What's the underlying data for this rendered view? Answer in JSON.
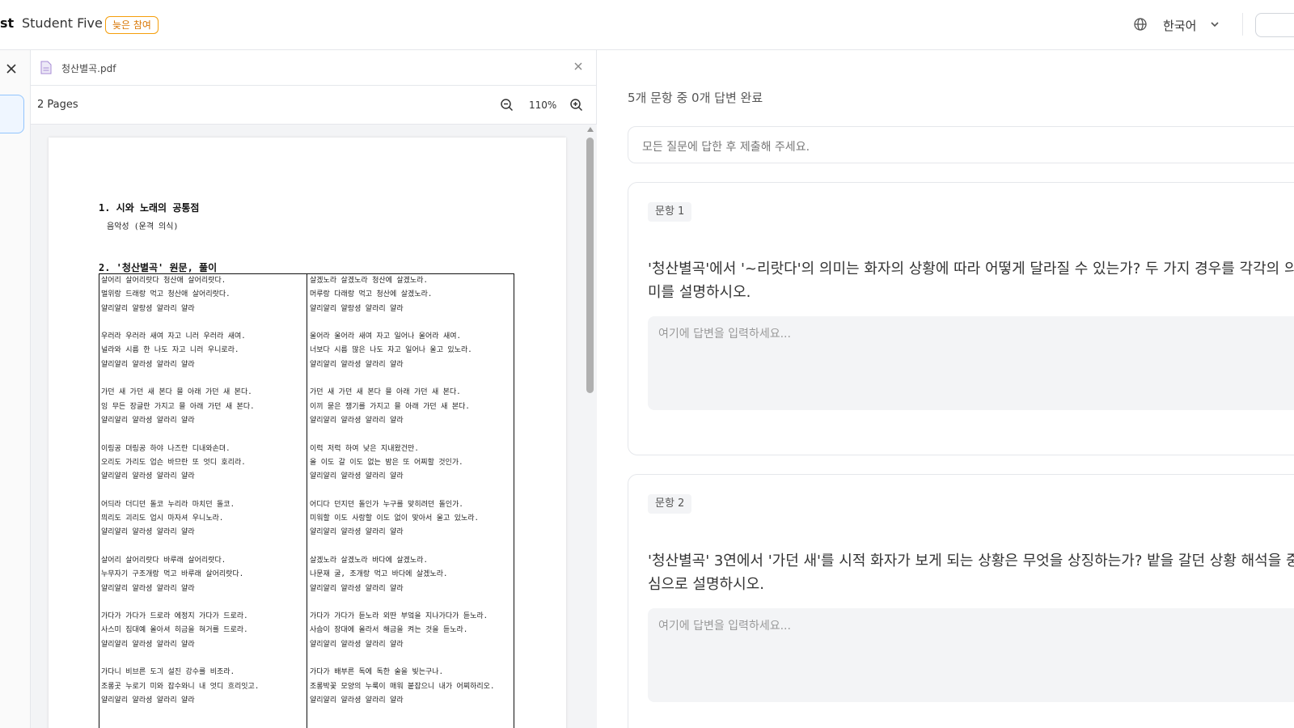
{
  "header": {
    "brand_fragment": "st",
    "student_name": "Student Five",
    "late_badge": "늦은 참여",
    "language": "한국어"
  },
  "viewer": {
    "file_name": "청산별곡.pdf",
    "pages_label": "2 Pages",
    "zoom_level": "110%",
    "document": {
      "heading1": "1. 시와 노래의 공통점",
      "subtext": "음악성 (운격 의식)",
      "heading2": "2. '청산별곡' 원문, 풀이",
      "left_column": [
        [
          "살어리 살어리랏다 청산애 살어리랏다.",
          "멀위랑 드래랑 먹고 청산애 살어리랏다.",
          "얄리얄리 얄랑셩 얄라리 얄라"
        ],
        [
          "우러라 우러라 새여 자고 니러 우러라 새여.",
          "널라와 시름 한 나도 자고 니러 우니로라.",
          "얄리얄리 얄라셩 얄라리 얄라"
        ],
        [
          "가던 새 가던 새 본다 믈 아래 가던 새 본다.",
          "잉 무든 장글란 가지고 믈 아래 가던 새 본다.",
          "얄리얄리 얄라셩 얄라리 얄라"
        ],
        [
          "이링공 뎌링공 하야 나즈란 디내와손뎌.",
          "오리도 가리도 업슨 바므란 또 엇디 호리라.",
          "얄리얄리 얄라셩 얄라리 얄라"
        ],
        [
          "어듸라 더디던 돌코 누리라 마치던 돌코.",
          "믜리도 괴리도 업시 마자셔 우니노라.",
          "얄리얄리 얄라셩 얄라리 얄라"
        ],
        [
          "살어리 살어리랏다 바루래 살어리랏다.",
          "누무자기 구조개랑 먹고 바루래 살어리랏다.",
          "얄리얄리 얄라셩 얄라리 얄라"
        ],
        [
          "가다가 가다가 드로라 에정지 가다가 드로라.",
          "사스미 짐대예 올아셔 히금을 혀거를 드로라.",
          "얄리얄리 얄라셩 얄라리 얄라"
        ],
        [
          "가다니 비브른 도긔 설진 강수를 비조라.",
          "조롱곳 누로기 미와 잡수와니 내 엇디 흐리잇고.",
          "얄리얄리 얄라셩 얄라리 얄라"
        ]
      ],
      "right_column": [
        [
          "살겠노라 살겠노라 청산에 살겠노라.",
          "머루랑 다래랑 먹고 청산에 살겠노라.",
          "얄리얄리 얄랑셩 얄라리 얄라"
        ],
        [
          "울어라 울어라 새여 자고 일어나 울어라 새여.",
          "너보다 시름 많은 나도 자고 일어나 울고 있노라.",
          "얄리얄리 얄라셩 얄라리 얄라"
        ],
        [
          "가던 새 가던 새 본다 믈 아래 가던 새 본다.",
          "이끼 묻은 쟁기를 가지고 믈 아래 가던 새 본다.",
          "얄리얄리 얄라셩 얄라리 얄라"
        ],
        [
          "이럭 저럭 하여 낮은 지내왔건만.",
          "올 이도 갈 이도 없는 밤은 또 어찌할 것인가.",
          "얄리얄리 얄라셩 얄라리 얄라"
        ],
        [
          "어디다 던지던 돌인가 누구를 맞히려던 돌인가.",
          "미워할 이도 사랑할 이도 없이 맞아서 울고 있노라.",
          "얄리얄리 얄라셩 얄라리 얄라"
        ],
        [
          "살겠노라 살겠노라 바다에 살겠노라.",
          "나문재 굴, 조개랑 먹고 바다에 살겠노라.",
          "얄리얄리 얄라셩 얄라리 얄라"
        ],
        [
          "가다가 가다가 듣노라 외딴 부엌을 지나가다가 듣노라.",
          "사슴이 장대에 올라서 해금을 켜는 것을 듣노라.",
          "얄리얄리 얄라셩 얄라리 얄라"
        ],
        [
          "가다가 배부른 독에 독한 술을 빚는구나.",
          "조롱박꽃 모양의 누룩이 매워 붙잡으니 내가 어찌하리오.",
          "얄리얄리 얄라셩 얄라리 얄라"
        ]
      ]
    }
  },
  "main": {
    "progress_text": "5개 문항 중 0개 답변 완료",
    "notice_text": "모든 질문에 답한 후 제출해 주세요.",
    "questions": [
      {
        "badge": "문항 1",
        "text": "'청산별곡'에서 '~리랏다'의 의미는 화자의 상황에 따라 어떻게 달라질 수 있는가? 두 가지 경우를 각각의 의미를 설명하시오.",
        "answer_placeholder": "여기에 답변을 입력하세요..."
      },
      {
        "badge": "문항 2",
        "text": "'청산별곡' 3연에서 '가던 새'를 시적 화자가 보게 되는 상황은 무엇을 상징하는가? 밭을 갈던 상황 해석을 중심으로 설명하시오.",
        "answer_placeholder": "여기에 답변을 입력하세요..."
      }
    ]
  },
  "icons": {
    "globe": "globe-icon",
    "chevron": "chevron-down-icon",
    "close": "close-icon",
    "pdf": "pdf-file-icon",
    "zoom_out": "zoom-out-icon",
    "zoom_in": "zoom-in-icon"
  },
  "colors": {
    "late_badge": "#d97706",
    "active_rail": "#93c5fd"
  }
}
